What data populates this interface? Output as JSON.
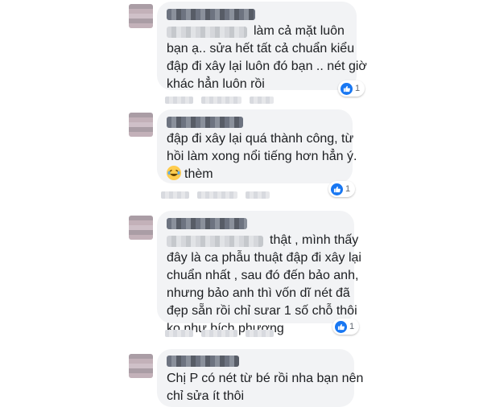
{
  "comments": [
    {
      "lines": [
        "làm cả mặt luôn",
        "bạn ạ.. sửa hết tất cả chuẩn kiểu",
        "đập đi xây lại luôn đó bạn .. nét giờ",
        "khác hẳn luôn rồi"
      ],
      "reactions": "1"
    },
    {
      "lines": [
        "đập đi xây lại quá thành công, từ",
        "hồi làm xong nổi tiếng hơn hẳn ý."
      ],
      "emoji_text": "thèm",
      "emoji_icon": "laughing-tears-emoji",
      "reactions": "1"
    },
    {
      "lines": [
        "thật , mình thấy",
        "đây là ca phẫu thuật đập đi xây lại",
        "chuẩn nhất , sau đó đến bảo anh,",
        "nhưng bảo anh thì vốn dĩ nét đã",
        "đẹp sẵn rồi chỉ sưar 1 số chỗ thôi",
        "ko như bích phương"
      ],
      "reactions": "1"
    },
    {
      "lines": [
        "Chị P có nét từ bé rồi nha bạn nên",
        "chỉ sửa ít thôi"
      ]
    }
  ],
  "colors": {
    "bubble": "#f2f3f5",
    "like_blue": "#1877f2",
    "text": "#1c1e21"
  },
  "icons": {
    "like": "thumbs-up-icon"
  }
}
